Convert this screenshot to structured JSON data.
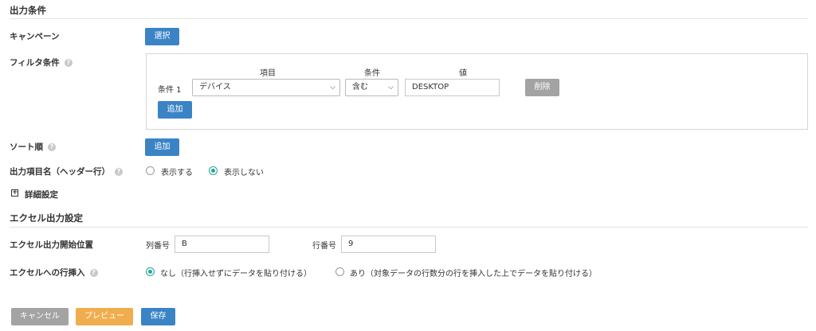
{
  "output_conditions": {
    "section_title": "出力条件",
    "campaign": {
      "label": "キャンペーン",
      "select_button": "選択"
    },
    "filter": {
      "label": "フィルタ条件",
      "col_item": "項目",
      "col_condition": "条件",
      "col_value": "値",
      "rows": [
        {
          "label": "条件 1",
          "item": "デバイス",
          "condition": "含む",
          "value": "DESKTOP",
          "delete_button": "削除"
        }
      ],
      "add_button": "追加"
    },
    "sort": {
      "label": "ソート順",
      "add_button": "追加"
    },
    "header_row": {
      "label": "出力項目名（ヘッダー行）",
      "options": [
        {
          "label": "表示する",
          "checked": false
        },
        {
          "label": "表示しない",
          "checked": true
        }
      ]
    },
    "advanced": {
      "toggle_symbol": "+",
      "label": "詳細設定"
    }
  },
  "excel_output": {
    "section_title": "エクセル出力設定",
    "start_position": {
      "label": "エクセル出力開始位置",
      "column_label": "列番号",
      "column_value": "B",
      "row_label": "行番号",
      "row_value": "9"
    },
    "row_insert": {
      "label": "エクセルへの行挿入",
      "options": [
        {
          "label": "なし（行挿入せずにデータを貼り付ける）",
          "checked": true
        },
        {
          "label": "あり（対象データの行数分の行を挿入した上でデータを貼り付ける）",
          "checked": false
        }
      ]
    }
  },
  "footer": {
    "cancel_button": "キャンセル",
    "preview_button": "プレビュー",
    "save_button": "保存"
  },
  "colors": {
    "primary": "#3a84c6",
    "gray_button": "#a3a3a3",
    "orange_button": "#f0ad4e",
    "radio_checked": "#26a69a"
  },
  "icons": {
    "help": "question-circle-icon",
    "dropdown": "chevron-down-icon",
    "expand": "plus-square-icon"
  }
}
